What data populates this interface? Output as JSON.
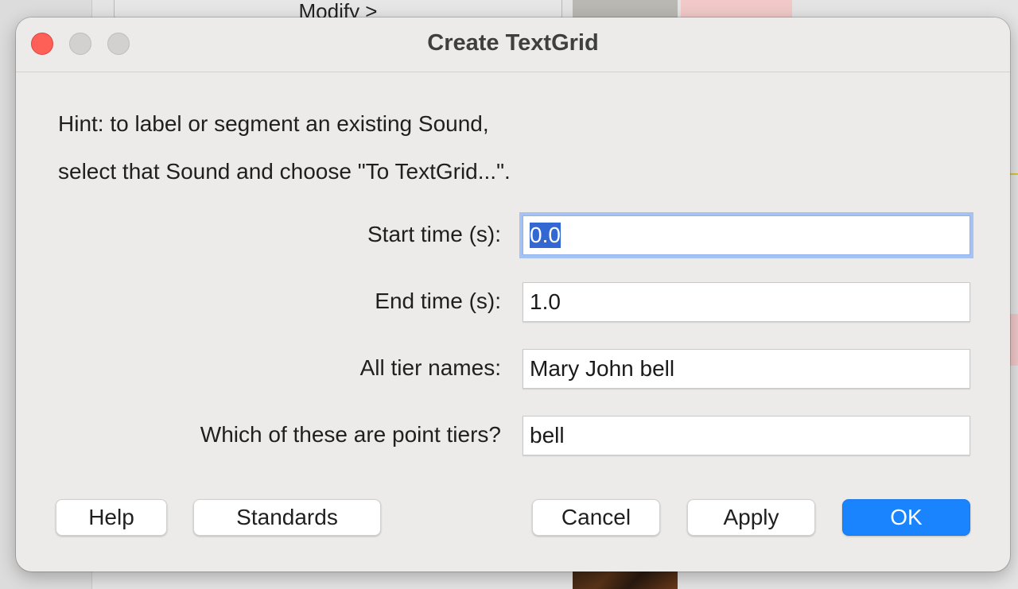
{
  "background": {
    "menu_button_label": "Modify  >"
  },
  "dialog": {
    "title": "Create TextGrid",
    "hint_line1": "Hint: to label or segment an existing Sound,",
    "hint_line2": "select that Sound and choose \"To TextGrid...\".",
    "fields": {
      "start_time": {
        "label": "Start time (s):",
        "value": "0.0"
      },
      "end_time": {
        "label": "End time (s):",
        "value": "1.0"
      },
      "tier_names": {
        "label": "All tier names:",
        "value": "Mary John bell"
      },
      "point_tiers": {
        "label": "Which of these are point tiers?",
        "value": "bell"
      }
    },
    "buttons": {
      "help": "Help",
      "standards": "Standards",
      "cancel": "Cancel",
      "apply": "Apply",
      "ok": "OK"
    }
  },
  "colors": {
    "primary_button": "#1a84ff",
    "focus_ring": "#a6c2f2",
    "close_button": "#fe5f57"
  }
}
